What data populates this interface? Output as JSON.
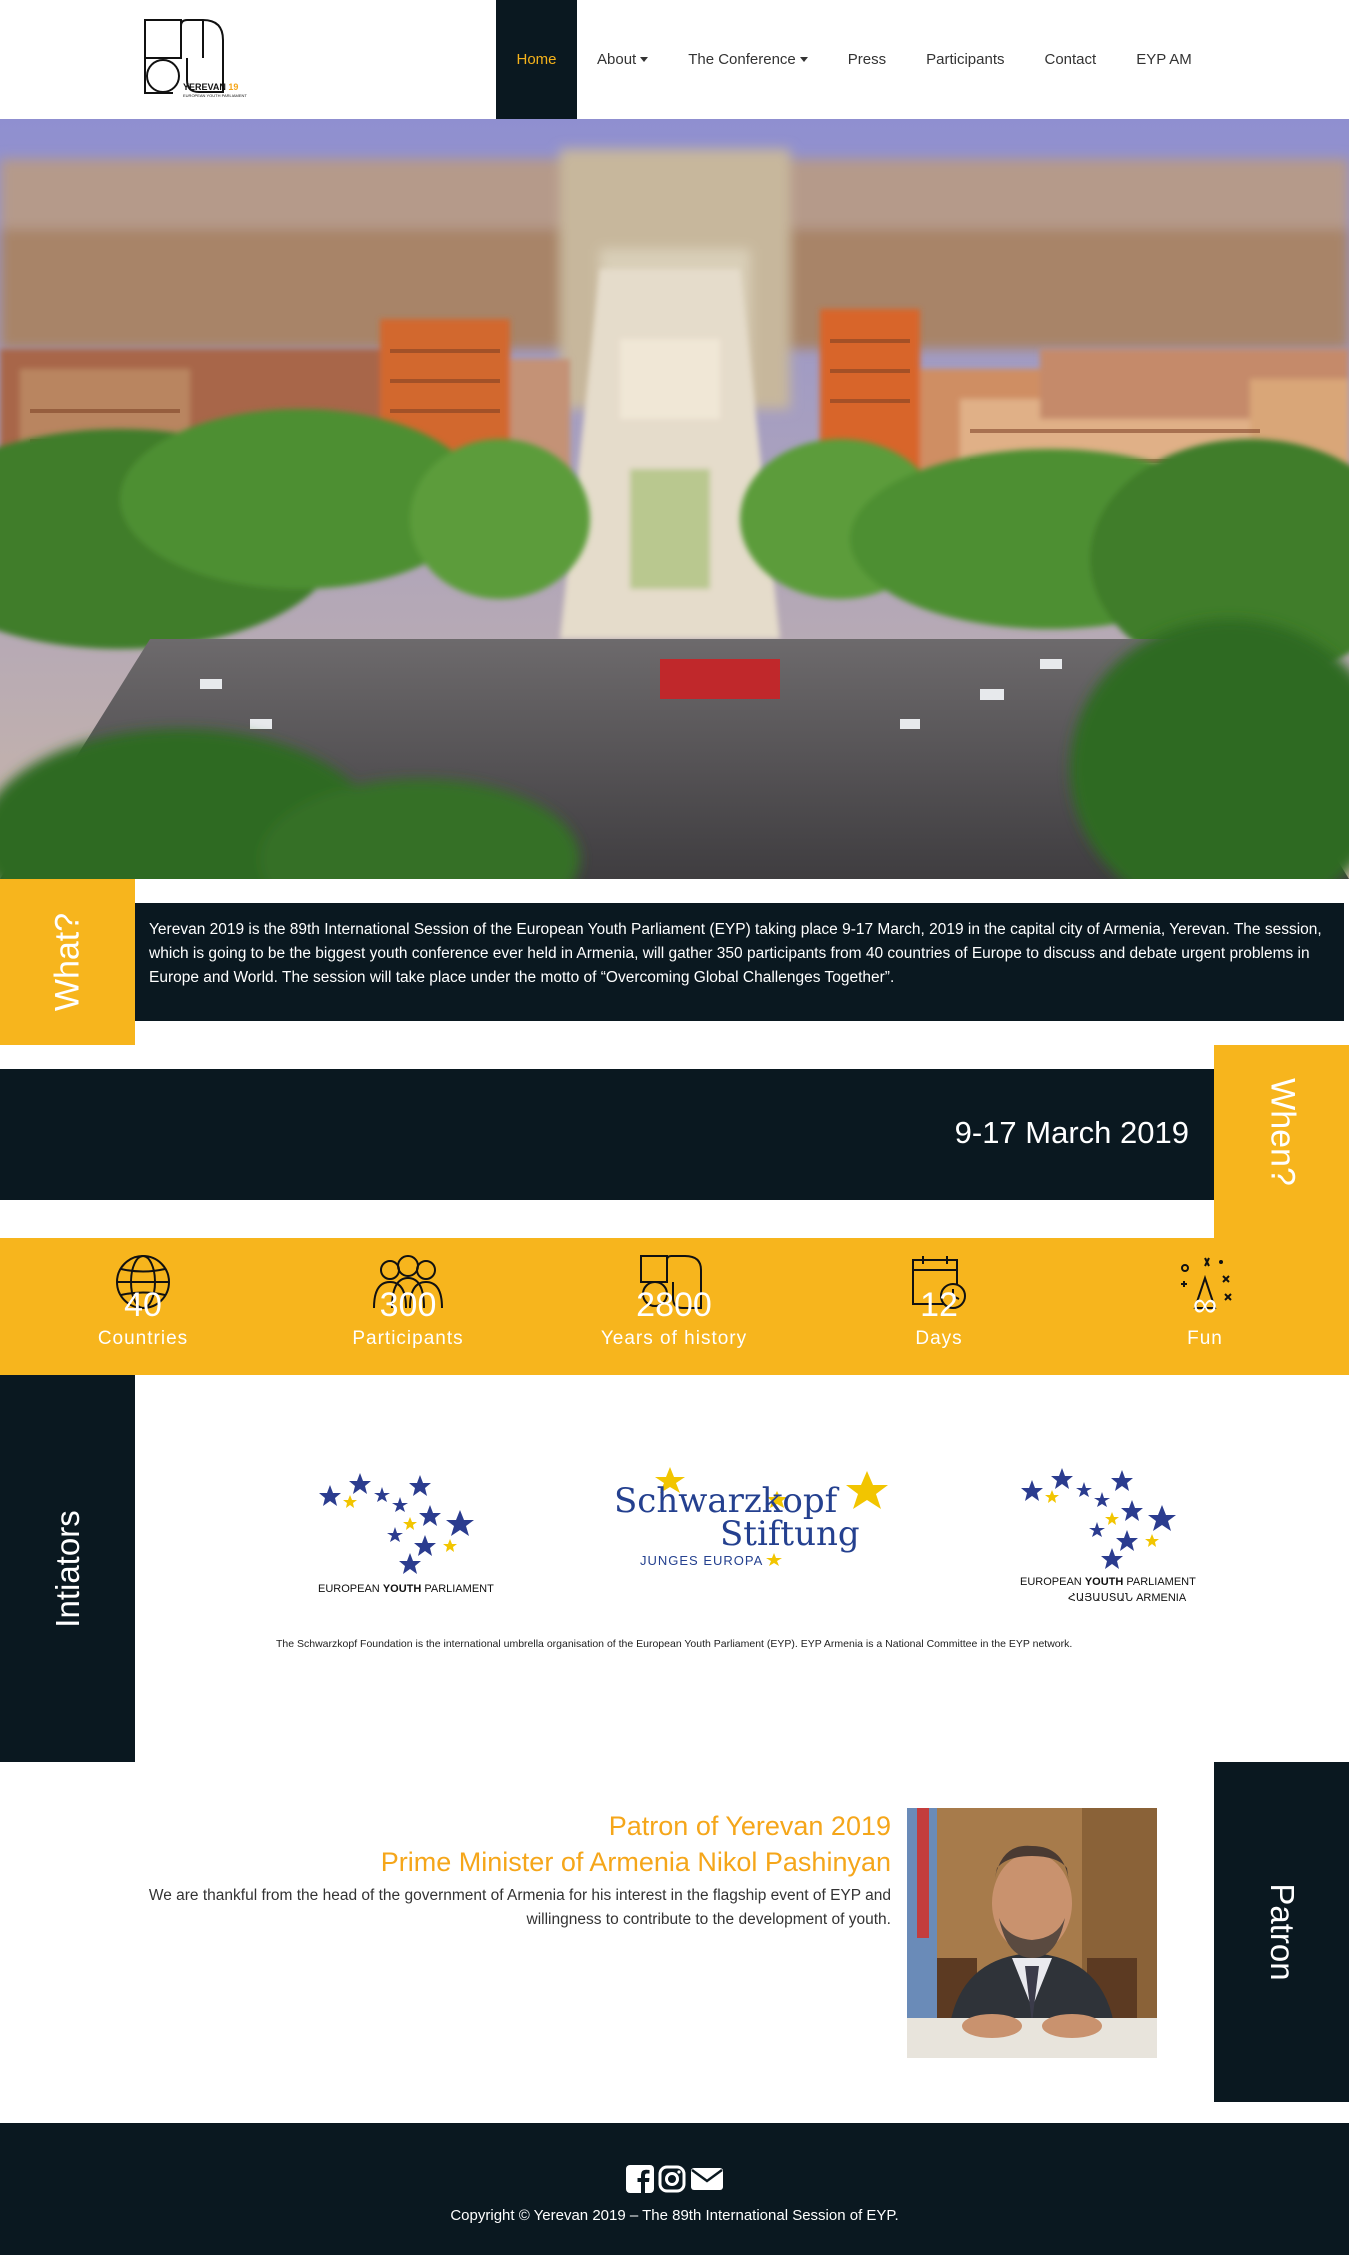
{
  "logo": {
    "text": "YEREVAN",
    "accent": "19",
    "tagline": "EUROPEAN YOUTH PARLIAMENT"
  },
  "nav": {
    "items": [
      {
        "label": "Home",
        "active": true,
        "dropdown": false
      },
      {
        "label": "About",
        "active": false,
        "dropdown": true
      },
      {
        "label": "The Conference",
        "active": false,
        "dropdown": true
      },
      {
        "label": "Press",
        "active": false,
        "dropdown": false
      },
      {
        "label": "Participants",
        "active": false,
        "dropdown": false
      },
      {
        "label": "Contact",
        "active": false,
        "dropdown": false
      },
      {
        "label": "EYP AM",
        "active": false,
        "dropdown": false
      }
    ]
  },
  "what": {
    "heading": "What?",
    "text": "Yerevan 2019 is the 89th International Session of the European Youth Parliament (EYP) taking place 9-17 March, 2019 in the capital city of Armenia, Yerevan. The session, which is going to be the biggest youth conference ever held in Armenia, will gather 350 participants from 40 countries of Europe to discuss and debate urgent problems in Europe and World. The session will take place under the motto of “Overcoming Global Challenges Together”."
  },
  "when": {
    "heading": "When?",
    "date": "9-17 March 2019"
  },
  "stats": [
    {
      "number": "40",
      "label": "Countries",
      "icon": "globe-icon"
    },
    {
      "number": "300",
      "label": "Participants",
      "icon": "people-icon"
    },
    {
      "number": "2800",
      "label": "Years of history",
      "icon": "yerevan-logo-icon"
    },
    {
      "number": "12",
      "label": "Days",
      "icon": "calendar-clock-icon"
    },
    {
      "number": "∞",
      "label": "Fun",
      "icon": "party-icon"
    }
  ],
  "initiators": {
    "heading": "Intiators",
    "eyp": {
      "line1": "EUROPEAN",
      "bold": "YOUTH",
      "line1b": "PARLIAMENT"
    },
    "schwarzkopf": {
      "line1": "Schwarzkopf",
      "line2": "Stiftung",
      "line3": "JUNGES EUROPA"
    },
    "eyp_am": {
      "line1": "EUROPEAN",
      "bold": "YOUTH",
      "line1b": "PARLIAMENT",
      "line2a": "ՀԱՅԱՍՏԱՆ",
      "line2b": "ARMENIA"
    },
    "note": "The Schwarzkopf Foundation is the international umbrella organisation of the European Youth Parliament (EYP). EYP Armenia is a National Committee in the EYP network."
  },
  "patron": {
    "heading": "Patron",
    "title1": "Patron of Yerevan 2019",
    "title2": "Prime Minister of Armenia Nikol Pashinyan",
    "text": "We are thankful from the head of the government of Armenia for his interest in the flagship event of EYP and willingness to contribute to the development of youth."
  },
  "footer": {
    "social": [
      "facebook-icon",
      "instagram-icon",
      "email-icon"
    ],
    "copyright": "Copyright © Yerevan 2019 – The 89th International Session of EYP."
  },
  "colors": {
    "accent": "#f7b51d",
    "dark": "#0a1820",
    "eu_blue": "#2b3c8f",
    "eu_yellow": "#f2c500"
  }
}
